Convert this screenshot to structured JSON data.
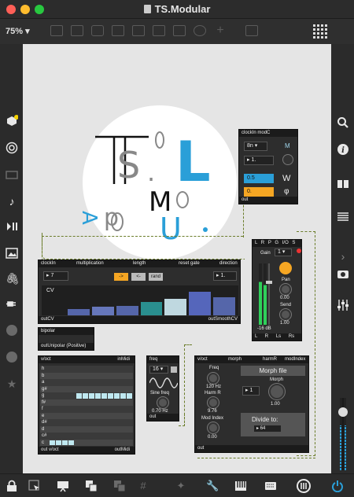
{
  "window": {
    "title": "TS.Modular"
  },
  "toolbar": {
    "zoom": "75%"
  },
  "logo": {
    "letters": [
      "T",
      "S",
      ".",
      "L",
      "M",
      "O",
      "U",
      ".",
      "d",
      "A"
    ]
  },
  "modules": {
    "clockin": {
      "header": [
        "clockIn",
        "modC"
      ],
      "rate": "8n",
      "m_label": "M",
      "mult": "1.",
      "val1": "0.5",
      "val2": "0.",
      "w_label": "W",
      "phi_label": "φ",
      "footer": "out"
    },
    "seq": {
      "header": [
        "clockIn",
        "multiplication",
        "length",
        "reset gate",
        "direction"
      ],
      "in_value": "7",
      "dir_value": "1.",
      "buttons": [
        "->",
        "<-",
        "rand"
      ],
      "cv_label": "CV",
      "steps": [
        0.22,
        0.28,
        0.32,
        0.45,
        0.55,
        0.78,
        0.6
      ],
      "footer_left": "outCV",
      "footer_right": "outSmoothCV"
    },
    "bipolar": {
      "header": "bipolar",
      "footer": "outUnipolar (Positive)"
    },
    "midi": {
      "header_left": "v/oct",
      "header_right": "inMidi",
      "keys": [
        "h",
        "b",
        "a",
        "g#",
        "g",
        "f#",
        "f",
        "e",
        "d#",
        "d",
        "c#",
        "c"
      ],
      "footer_left": "out v/oct",
      "footer_right": "outMidi"
    },
    "lfo": {
      "header": "freq",
      "rate": "16",
      "freq_label": "Sine freq",
      "freq_value": "0.70 Hz",
      "footer": "out"
    },
    "gain": {
      "header": [
        "L",
        "R",
        "P",
        "G",
        "I/O",
        "S"
      ],
      "gain_label": "Gain",
      "gain_sel": "1",
      "pan_label": "Pan",
      "pan_value": "0.00",
      "send_label": "Send",
      "send_value": "1.00",
      "db_value": "-16 dB",
      "footer": [
        "L",
        "R",
        "Ls",
        "Rs"
      ]
    },
    "morph": {
      "header": [
        "v/oct",
        "morph",
        "harmR",
        "modIndex"
      ],
      "freq_label": "Freq",
      "freq_value": "120 Hz",
      "harm_label": "Harm R",
      "harm_value": "9.76",
      "mod_label": "Mod Index",
      "mod_value": "0.00",
      "file_button": "Morph file",
      "num_value": "1",
      "morph_label": "Morph",
      "morph_value": "1.00",
      "divide_label": "Divide to:",
      "divide_value": "64",
      "footer": "out"
    }
  },
  "colors": {
    "accent_blue": "#2a9fd8",
    "cable": "#6b7d2a",
    "orange": "#f5a623",
    "meter_green": "#2fd05a"
  }
}
